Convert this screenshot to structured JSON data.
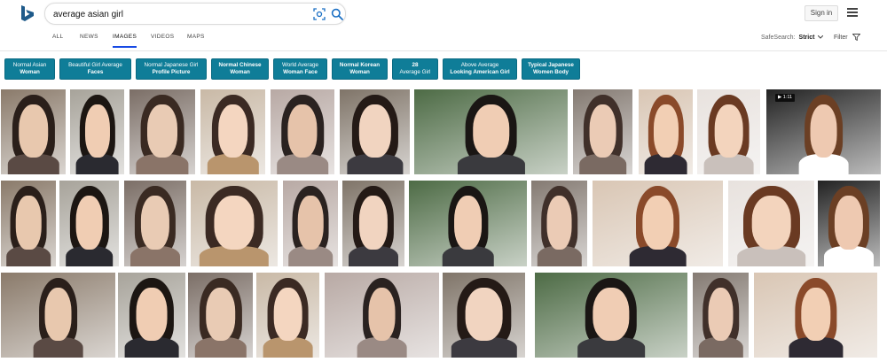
{
  "search": {
    "query": "average asian girl"
  },
  "header": {
    "signin_label": "Sign in"
  },
  "tabs": [
    {
      "label": "ALL"
    },
    {
      "label": "NEWS"
    },
    {
      "label": "IMAGES",
      "active": true
    },
    {
      "label": "VIDEOS"
    },
    {
      "label": "MAPS"
    }
  ],
  "safesearch": {
    "label": "SafeSearch:",
    "value": "Strict"
  },
  "filter": {
    "label": "Filter"
  },
  "pills": [
    {
      "line1": "Normal Asian",
      "line2": "Woman"
    },
    {
      "line1": "Beautiful Girl Average",
      "line2": "Faces"
    },
    {
      "line1": "Normal Japanese Girl",
      "line2": "Profile Picture"
    },
    {
      "line1": "Normal Chinese",
      "line2": "Woman"
    },
    {
      "line1": "World Average",
      "line2": "Woman Face"
    },
    {
      "line1": "Normal Korean",
      "line2": "Woman"
    },
    {
      "line1": "28",
      "line2": "Average Girl"
    },
    {
      "line1": "Above Average",
      "line2": "Looking American Girl"
    },
    {
      "line1": "Typical Japanese",
      "line2": "Women Body"
    }
  ],
  "video_badge": "▶ 1:11",
  "colors": {
    "accent": "#0f7d98",
    "tab_underline": "#174ae4"
  }
}
